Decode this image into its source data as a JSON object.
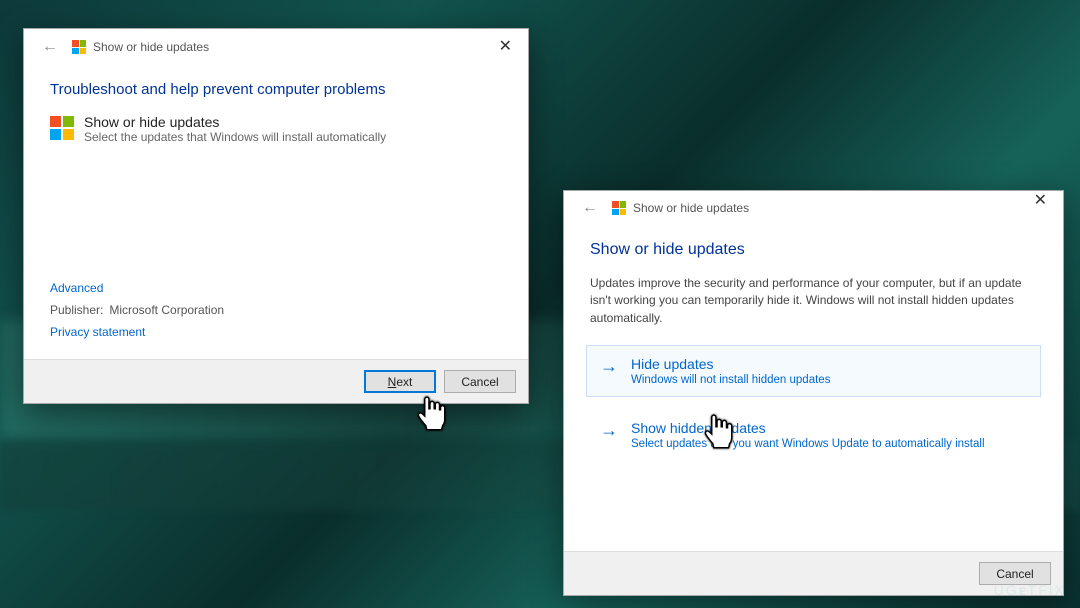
{
  "dialog1": {
    "title": "Show or hide updates",
    "headline": "Troubleshoot and help prevent computer problems",
    "section_title": "Show or hide updates",
    "section_sub": "Select the updates that Windows will install automatically",
    "advanced": "Advanced",
    "publisher_label": "Publisher:",
    "publisher_value": "Microsoft Corporation",
    "privacy": "Privacy statement",
    "next": "Next",
    "cancel": "Cancel"
  },
  "dialog2": {
    "title": "Show or hide updates",
    "headline": "Show or hide updates",
    "body": "Updates improve the security and performance of your computer, but if an update isn't working you can temporarily hide it. Windows will not install hidden updates automatically.",
    "opt1_title": "Hide updates",
    "opt1_sub": "Windows will not install hidden updates",
    "opt2_title": "Show hidden updates",
    "opt2_sub": "Select updates that you want Windows Update to automatically install",
    "cancel": "Cancel"
  },
  "watermark": "UG🔧TFIX"
}
